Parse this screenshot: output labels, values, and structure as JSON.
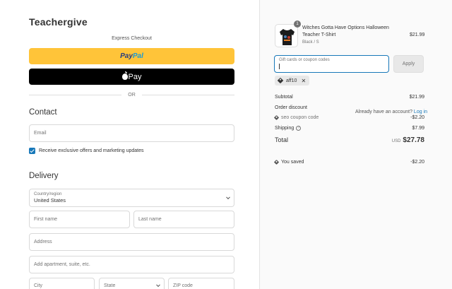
{
  "store": {
    "name": "Teachergive"
  },
  "express": {
    "title": "Express Checkout",
    "paypal_part1": "Pay",
    "paypal_part2": "Pal",
    "applepay_label": "Pay",
    "or_label": "OR"
  },
  "contact": {
    "heading": "Contact",
    "have_account": "Already have an account?",
    "login_link": "Log in",
    "email_placeholder": "Email",
    "offers_label": "Receive exclusive offers and marketing updates",
    "offers_checked": true
  },
  "delivery": {
    "heading": "Delivery",
    "country_label": "Country/region",
    "country_value": "United States",
    "first_name_placeholder": "First name",
    "last_name_placeholder": "Last name",
    "address_placeholder": "Address",
    "apartment_placeholder": "Add apartment, suite, etc.",
    "city_placeholder": "City",
    "state_placeholder": "State",
    "zip_placeholder": "ZIP code"
  },
  "cart": {
    "item": {
      "quantity": "1",
      "name": "Witches Gotta Have Options Halloween Teacher T-Shirt",
      "variant": "Black / S",
      "price": "$21.99",
      "thumbnail_icon": "tshirt-icon"
    },
    "coupon_placeholder": "Gift cards or coupon codes",
    "apply_label": "Apply",
    "applied_code": "aff10"
  },
  "summary": {
    "subtotal_label": "Subtotal",
    "subtotal_value": "$21.99",
    "order_discount_label": "Order discount",
    "discount_code_label": "seo coupon code",
    "discount_value": "-$2.20",
    "shipping_label": "Shipping",
    "shipping_value": "$7.99",
    "total_label": "Total",
    "currency": "USD",
    "total_value": "$27.78",
    "saved_label": "You saved",
    "saved_value": "-$2.20"
  },
  "colors": {
    "accent": "#1878b9",
    "paypal_yellow": "#ffc439",
    "applepay_black": "#000000"
  }
}
